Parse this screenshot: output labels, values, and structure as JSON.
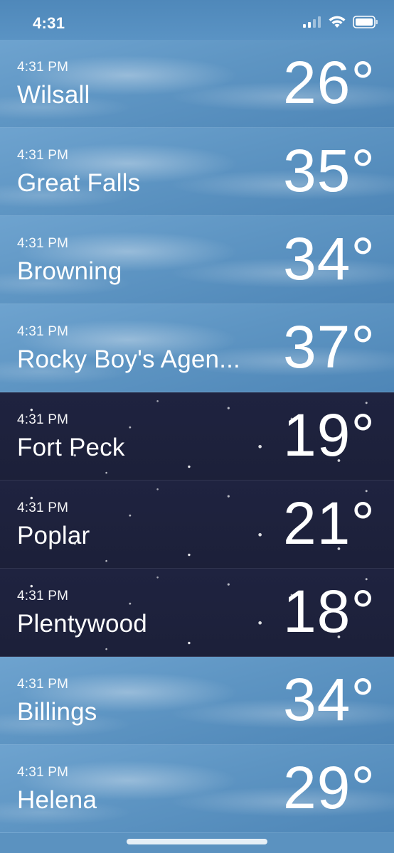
{
  "status_bar": {
    "time": "4:31"
  },
  "cities": [
    {
      "time": "4:31 PM",
      "name": "Wilsall",
      "temp": "26°",
      "theme": "day"
    },
    {
      "time": "4:31 PM",
      "name": "Great Falls",
      "temp": "35°",
      "theme": "day"
    },
    {
      "time": "4:31 PM",
      "name": "Browning",
      "temp": "34°",
      "theme": "day"
    },
    {
      "time": "4:31 PM",
      "name": "Rocky Boy's Agen...",
      "temp": "37°",
      "theme": "day"
    },
    {
      "time": "4:31 PM",
      "name": "Fort Peck",
      "temp": "19°",
      "theme": "night"
    },
    {
      "time": "4:31 PM",
      "name": "Poplar",
      "temp": "21°",
      "theme": "night"
    },
    {
      "time": "4:31 PM",
      "name": "Plentywood",
      "temp": "18°",
      "theme": "night"
    },
    {
      "time": "4:31 PM",
      "name": "Billings",
      "temp": "34°",
      "theme": "day"
    },
    {
      "time": "4:31 PM",
      "name": "Helena",
      "temp": "29°",
      "theme": "day"
    }
  ],
  "colors": {
    "day_sky": "#5e95c3",
    "night_sky": "#1f2340",
    "text": "#ffffff"
  },
  "icons": {
    "signal": "cellular-signal-icon",
    "wifi": "wifi-icon",
    "battery": "battery-icon"
  }
}
